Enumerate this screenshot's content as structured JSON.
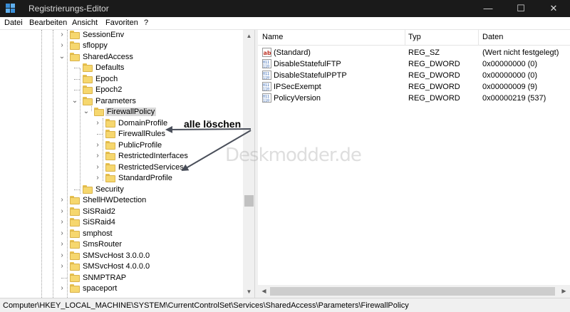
{
  "window": {
    "title": "Registrierungs-Editor",
    "minimize": "—",
    "maximize": "☐",
    "close": "✕"
  },
  "menu": [
    "Datei",
    "Bearbeiten",
    "Ansicht",
    "Favoriten",
    "?"
  ],
  "tree": {
    "items": [
      {
        "label": "SessionEnv",
        "expander": ">"
      },
      {
        "label": "sfloppy",
        "expander": ">"
      },
      {
        "label": "SharedAccess",
        "expander": "v"
      },
      {
        "label": "Defaults",
        "expander": ""
      },
      {
        "label": "Epoch",
        "expander": ""
      },
      {
        "label": "Epoch2",
        "expander": ""
      },
      {
        "label": "Parameters",
        "expander": "v"
      },
      {
        "label": "FirewallPolicy",
        "expander": "v"
      },
      {
        "label": "DomainProfile",
        "expander": ">"
      },
      {
        "label": "FirewallRules",
        "expander": ""
      },
      {
        "label": "PublicProfile",
        "expander": ">"
      },
      {
        "label": "RestrictedInterfaces",
        "expander": ">"
      },
      {
        "label": "RestrictedServices",
        "expander": ">"
      },
      {
        "label": "StandardProfile",
        "expander": ">"
      },
      {
        "label": "Security",
        "expander": ""
      },
      {
        "label": "ShellHWDetection",
        "expander": ">"
      },
      {
        "label": "SiSRaid2",
        "expander": ">"
      },
      {
        "label": "SiSRaid4",
        "expander": ">"
      },
      {
        "label": "smphost",
        "expander": ">"
      },
      {
        "label": "SmsRouter",
        "expander": ">"
      },
      {
        "label": "SMSvcHost 3.0.0.0",
        "expander": ">"
      },
      {
        "label": "SMSvcHost 4.0.0.0",
        "expander": ">"
      },
      {
        "label": "SNMPTRAP",
        "expander": ""
      },
      {
        "label": "spaceport",
        "expander": ">"
      }
    ]
  },
  "list": {
    "columns": [
      "Name",
      "Typ",
      "Daten"
    ],
    "rows": [
      {
        "name": "(Standard)",
        "type": "REG_SZ",
        "data": "(Wert nicht festgelegt)",
        "icon": "string-value-icon"
      },
      {
        "name": "DisableStatefulFTP",
        "type": "REG_DWORD",
        "data": "0x00000000 (0)",
        "icon": "dword-value-icon"
      },
      {
        "name": "DisableStatefulPPTP",
        "type": "REG_DWORD",
        "data": "0x00000000 (0)",
        "icon": "dword-value-icon"
      },
      {
        "name": "IPSecExempt",
        "type": "REG_DWORD",
        "data": "0x00000009 (9)",
        "icon": "dword-value-icon"
      },
      {
        "name": "PolicyVersion",
        "type": "REG_DWORD",
        "data": "0x00000219 (537)",
        "icon": "dword-value-icon"
      }
    ]
  },
  "status": {
    "path": "Computer\\HKEY_LOCAL_MACHINE\\SYSTEM\\CurrentControlSet\\Services\\SharedAccess\\Parameters\\FirewallPolicy"
  },
  "annotation": {
    "text": "alle löschen"
  },
  "watermark": "Deskmodder.de",
  "colors": {
    "titlebar": "#1a1a1a",
    "folder": "#f6d76e",
    "selection": "#d9d9d9"
  }
}
